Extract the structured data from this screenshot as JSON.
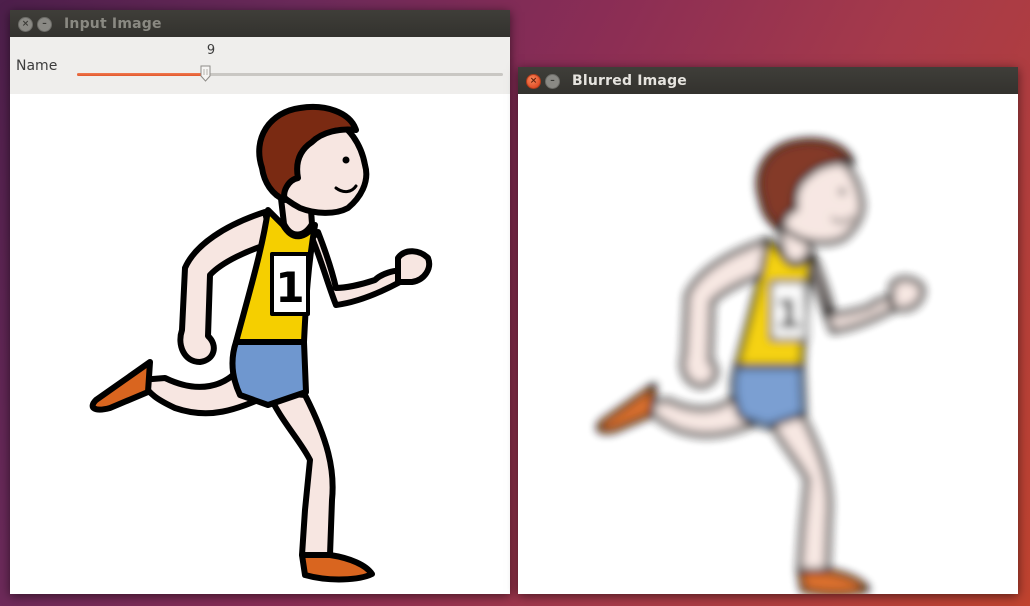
{
  "windows": {
    "input": {
      "title": "Input Image"
    },
    "blurred": {
      "title": "Blurred Image"
    }
  },
  "trackbar": {
    "label": "Name",
    "value": "9",
    "min": 0,
    "max": 30,
    "fraction": 0.3
  },
  "image": {
    "bib_number": "1",
    "description": "cartoon runner"
  },
  "colors": {
    "accent": "#e2572b",
    "hair": "#7a2a12",
    "skin": "#f7e6e1",
    "shirt": "#f5cf00",
    "shorts": "#6f97cf",
    "shoe": "#d9651f"
  }
}
